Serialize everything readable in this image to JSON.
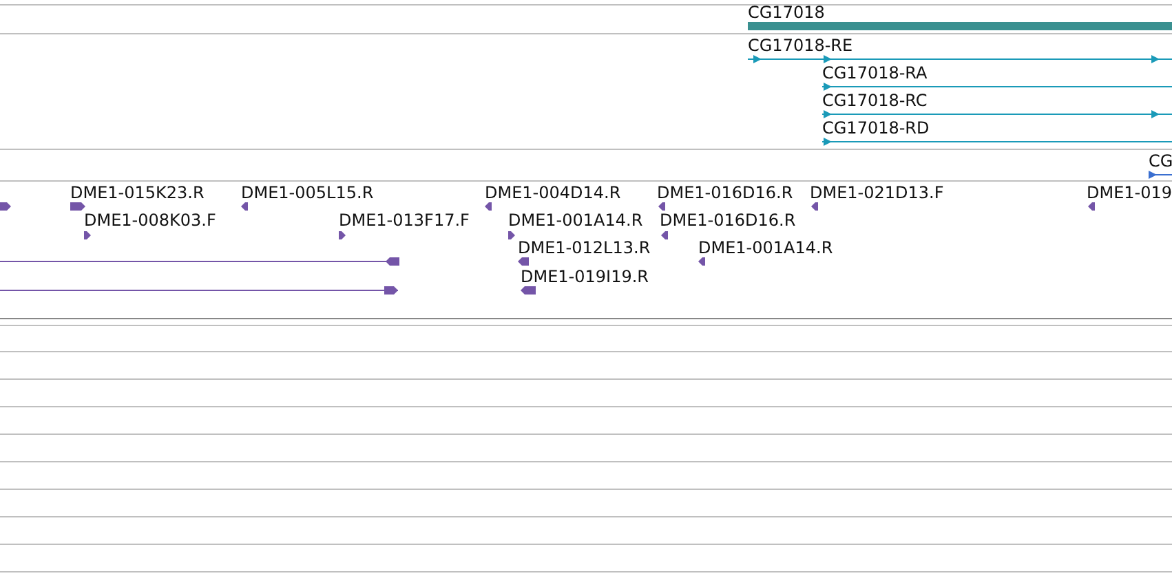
{
  "gene_track": {
    "genes": [
      {
        "label": "CG17018"
      }
    ]
  },
  "transcript_track": {
    "transcripts": [
      {
        "label": "CG17018-RE",
        "reverse": false
      },
      {
        "label": "CG17018-RA",
        "reverse": false
      },
      {
        "label": "CG17018-RC",
        "reverse": false
      },
      {
        "label": "CG17018-RD",
        "reverse": false
      }
    ]
  },
  "partial_gene_track": {
    "genes": [
      {
        "label": "CG",
        "reverse": false
      }
    ]
  },
  "est_track": {
    "features": [
      {
        "reverse": false
      },
      {
        "label": "DME1-015K23.R",
        "reverse": false
      },
      {
        "label": "DME1-005L15.R",
        "reverse": true
      },
      {
        "label": "DME1-004D14.R",
        "reverse": true
      },
      {
        "label": "DME1-016D16.R",
        "reverse": true
      },
      {
        "label": "DME1-021D13.F",
        "reverse": true
      },
      {
        "label": "DME1-019",
        "reverse": true
      },
      {
        "label": "DME1-008K03.F",
        "reverse": false
      },
      {
        "label": "DME1-013F17.F",
        "reverse": false
      },
      {
        "label": "DME1-001A14.R",
        "reverse": false
      },
      {
        "label": "DME1-016D16.R",
        "reverse": true
      },
      {
        "reverse": true
      },
      {
        "label": "DME1-012L13.R",
        "reverse": true
      },
      {
        "label": "DME1-001A14.R",
        "reverse": true
      },
      {
        "reverse": false
      },
      {
        "label": "DME1-019I19.R",
        "reverse": true
      }
    ]
  }
}
